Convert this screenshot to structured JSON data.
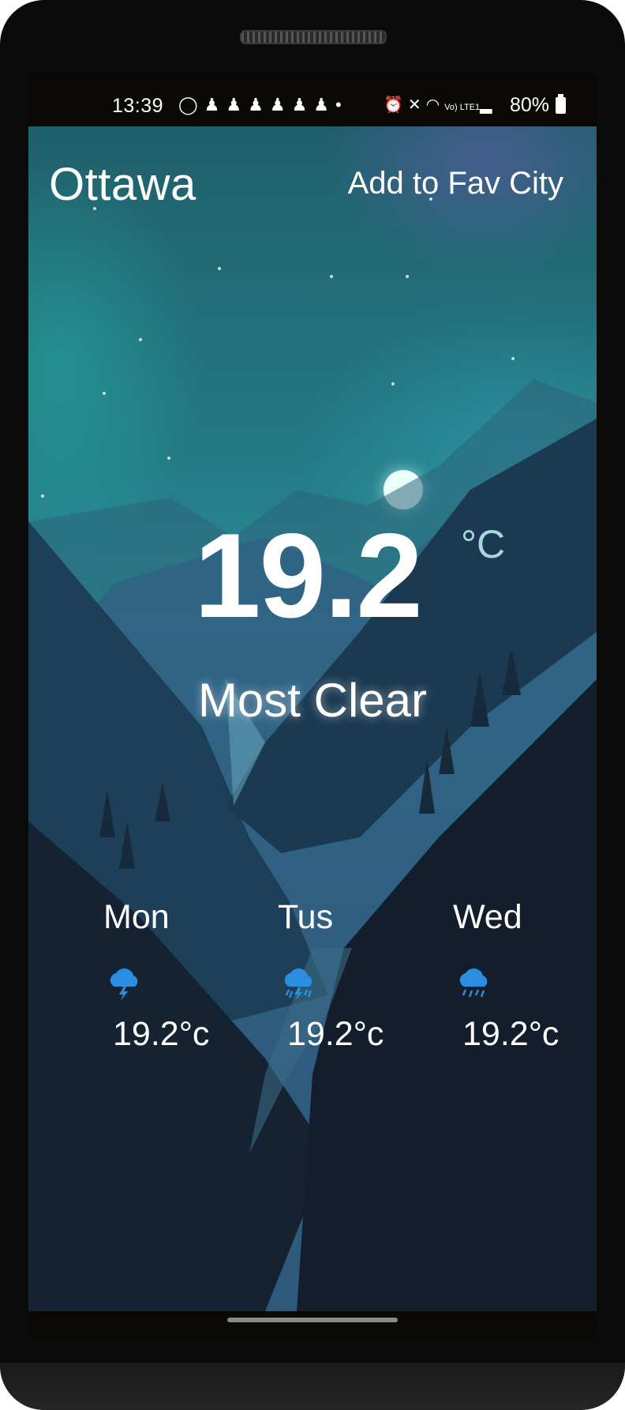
{
  "status_bar": {
    "time": "13:39",
    "notification_icons": [
      "whatsapp-icon",
      "snapchat-icon",
      "snapchat-icon",
      "snapchat-icon",
      "snapchat-icon",
      "snapchat-icon",
      "snapchat-icon",
      "dot-icon"
    ],
    "system_icons": [
      "alarm-icon",
      "mute-icon",
      "wifi-icon",
      "volte-icon",
      "signal-icon"
    ],
    "network_label": "Vo) LTE1",
    "battery": "80%"
  },
  "header": {
    "city": "Ottawa",
    "fav_button_label": "Add to Fav City"
  },
  "current": {
    "temperature": "19.2",
    "unit": "°C",
    "condition": "Most Clear"
  },
  "forecast": [
    {
      "day": "Mon",
      "icon": "cloud-lightning-icon",
      "temp": "19.2°c"
    },
    {
      "day": "Tus",
      "icon": "cloud-storm-rain-icon",
      "temp": "19.2°c"
    },
    {
      "day": "Wed",
      "icon": "cloud-rain-icon",
      "temp": "19.2°c"
    }
  ],
  "colors": {
    "icon_blue": "#2a8fe0",
    "text": "#ffffff",
    "unit_text": "#a8d8dc"
  }
}
